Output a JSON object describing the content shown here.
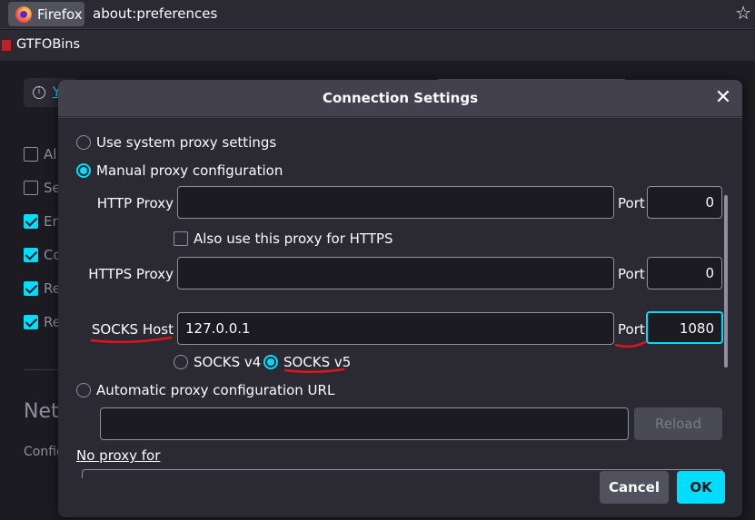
{
  "browser": {
    "identity_label": "Firefox",
    "url": "about:preferences",
    "bookmark_label": "GTFOBins"
  },
  "background": {
    "notice_link": "Y",
    "checkbox_rows": [
      {
        "label": "Al",
        "checked": false
      },
      {
        "label": "Se",
        "checked": false
      },
      {
        "label": "En",
        "checked": true
      },
      {
        "label": "Co",
        "checked": true
      },
      {
        "label": "Re",
        "checked": true
      },
      {
        "label": "Re",
        "checked": true
      }
    ],
    "heading": "Netv",
    "sub": "Config"
  },
  "dialog": {
    "title": "Connection Settings",
    "close_glyph": "✕",
    "options": {
      "system": "Use system proxy settings",
      "manual": "Manual proxy configuration",
      "auto": "Automatic proxy configuration URL"
    },
    "selected_option": "manual",
    "http_proxy": {
      "label": "HTTP Proxy",
      "value": "",
      "port_label": "Port",
      "port": "0"
    },
    "also_https": {
      "label": "Also use this proxy for HTTPS",
      "checked": false
    },
    "https_proxy": {
      "label": "HTTPS Proxy",
      "value": "",
      "port_label": "Port",
      "port": "0"
    },
    "socks": {
      "label": "SOCKS Host",
      "value": "127.0.0.1",
      "port_label": "Port",
      "port": "1080"
    },
    "socks_version": {
      "v4": "SOCKS v4",
      "v5": "SOCKS v5",
      "selected": "v5"
    },
    "auto_url": "",
    "reload_label": "Reload",
    "no_proxy_label": "No proxy for",
    "cancel_label": "Cancel",
    "ok_label": "OK"
  },
  "colors": {
    "accent": "#00ddff",
    "annotation": "#e0141e",
    "dialog_bg": "#2b2a33",
    "titlebar_bg": "#42414d"
  }
}
